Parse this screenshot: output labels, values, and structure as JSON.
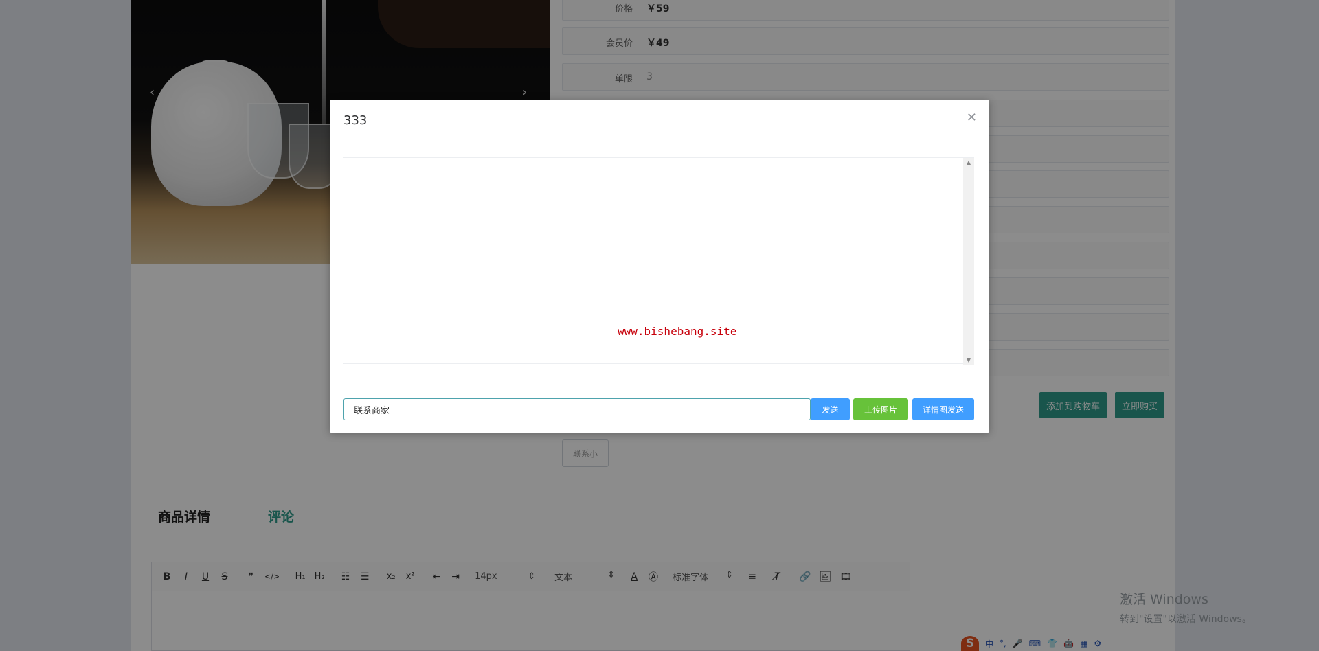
{
  "gallery": {
    "prev_arrow": "‹",
    "next_arrow": "›"
  },
  "product_info": {
    "rows": [
      {
        "label": "价格",
        "value": "￥59"
      },
      {
        "label": "会员价",
        "value": "￥49"
      },
      {
        "label": "单限",
        "value": "3"
      }
    ],
    "add_to_cart_label": "添加到购物车",
    "buy_now_label": "立即购买",
    "small_button_label": "联系小"
  },
  "details": {
    "tabs": [
      {
        "label": "商品详情"
      },
      {
        "label": "评论"
      }
    ],
    "editor": {
      "font_size": "14px",
      "paragraph_style": "文本",
      "font_family": "标准字体"
    }
  },
  "modal": {
    "title": "333",
    "watermark": "www.bishebang.site",
    "input_value": "联系商家",
    "send_label": "发送",
    "upload_label": "上传图片",
    "detail_send_label": "详情图发送"
  },
  "system": {
    "activation_line1": "激活 Windows",
    "activation_line2": "转到\"设置\"以激活 Windows。",
    "ime_logo": "S",
    "ime_items": [
      "中",
      "°,",
      "🎤",
      "⌨",
      "👕",
      "🤖",
      "▦",
      "⚙"
    ]
  },
  "colors": {
    "accent_teal": "#2f9c8b",
    "primary_blue": "#409eff",
    "success_green": "#67c23a",
    "watermark_red": "#c7000b"
  }
}
